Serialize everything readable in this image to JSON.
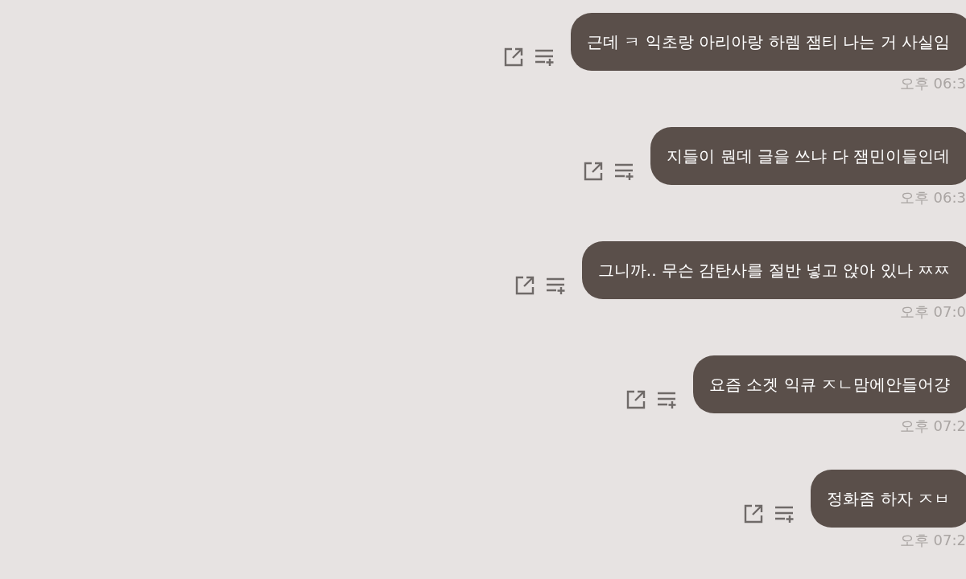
{
  "messages": [
    {
      "text": "근데 ㅋ 익초랑 아리아랑 하렘 잼티 나는 거 사실임",
      "time": "오후 06:3"
    },
    {
      "text": "지들이 뭔데 글을 쓰냐 다 잼민이들인데",
      "time": "오후 06:3"
    },
    {
      "text": "그니까.. 무슨 감탄사를 절반 넣고 앉아 있나 ㅉㅉ",
      "time": "오후 07:0"
    },
    {
      "text": "요즘 소겟 익큐 ㅈㄴ맘에안들어걍",
      "time": "오후 07:2"
    },
    {
      "text": "정화좀 하자 ㅈㅂ",
      "time": "오후 07:2"
    }
  ]
}
